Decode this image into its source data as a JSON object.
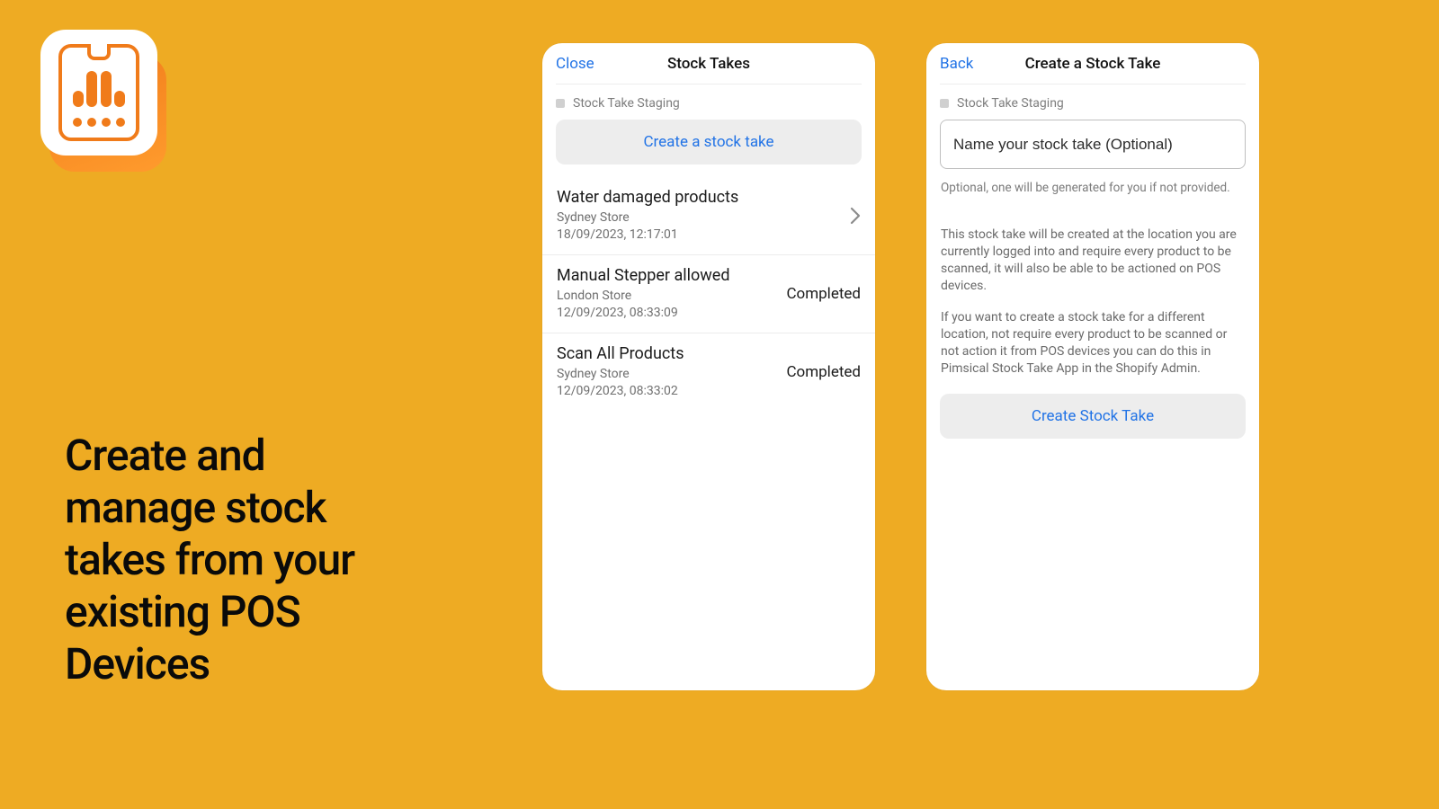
{
  "headline": "Create and manage stock takes from your existing POS Devices",
  "cardA": {
    "header": {
      "leftAction": "Close",
      "title": "Stock Takes"
    },
    "subhead": "Stock Take Staging",
    "primaryButton": "Create a stock take",
    "items": [
      {
        "title": "Water damaged products",
        "store": "Sydney Store",
        "timestamp": "18/09/2023, 12:17:01",
        "status": null,
        "chevron": true
      },
      {
        "title": "Manual Stepper allowed",
        "store": "London Store",
        "timestamp": "12/09/2023, 08:33:09",
        "status": "Completed",
        "chevron": false
      },
      {
        "title": "Scan All Products",
        "store": "Sydney Store",
        "timestamp": "12/09/2023, 08:33:02",
        "status": "Completed",
        "chevron": false
      }
    ]
  },
  "cardB": {
    "header": {
      "leftAction": "Back",
      "title": "Create a Stock Take"
    },
    "subhead": "Stock Take Staging",
    "input": {
      "placeholder": "Name your stock take (Optional)",
      "value": ""
    },
    "helper": "Optional, one will be generated for you if not provided.",
    "para1": "This stock take will be created at the location you are currently logged into and require every product to be scanned, it will also be able to be actioned on POS devices.",
    "para2": "If you want to create a stock take for a different location, not require every product to be scanned or not action it from POS devices you can do this in Pimsical Stock Take App in the Shopify Admin.",
    "primaryButton": "Create Stock Take"
  }
}
